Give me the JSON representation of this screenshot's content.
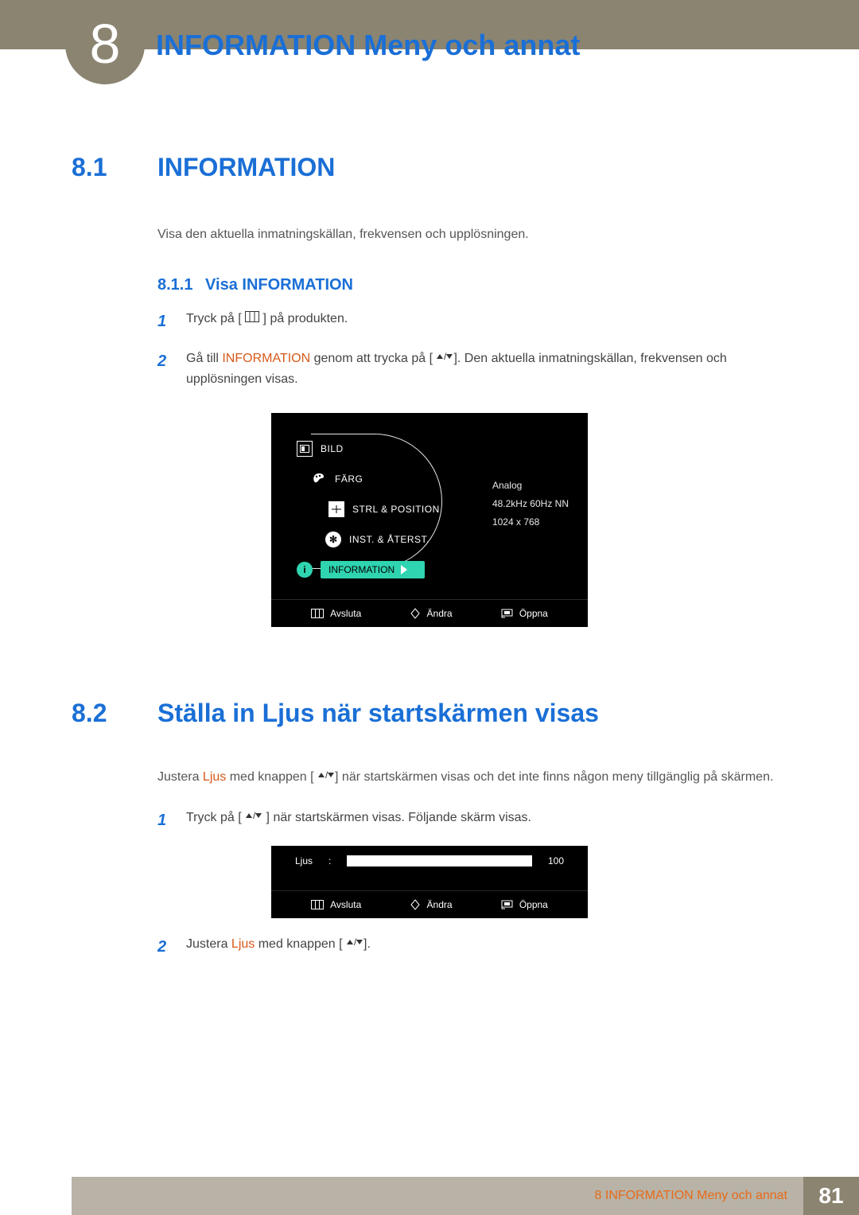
{
  "chapter": {
    "number": "8",
    "title": "INFORMATION Meny och annat"
  },
  "section1": {
    "num": "8.1",
    "title": "INFORMATION",
    "intro": "Visa den aktuella inmatningskällan, frekvensen och upplösningen.",
    "sub": {
      "num": "8.1.1",
      "title": "Visa INFORMATION"
    },
    "step1": {
      "n": "1",
      "a": "Tryck på [",
      "b": "] på produkten."
    },
    "step2": {
      "n": "2",
      "a": "Gå till ",
      "kw": "INFORMATION",
      "b": " genom att trycka på [",
      "c": "]. Den aktuella inmatningskällan, frekvensen och upplösningen visas."
    }
  },
  "osd1": {
    "items": {
      "bild": "BILD",
      "farg": "FÄRG",
      "strl": "STRL & POSITION",
      "inst": "INST. & ÅTERST.",
      "info": "INFORMATION"
    },
    "info": {
      "l1": "Analog",
      "l2": "48.2kHz 60Hz NN",
      "l3": "1024 x 768"
    },
    "footer": {
      "exit": "Avsluta",
      "change": "Ändra",
      "open": "Öppna"
    }
  },
  "section2": {
    "num": "8.2",
    "title": "Ställa in Ljus när startskärmen visas",
    "intro": {
      "a": "Justera ",
      "kw": "Ljus",
      "b": " med knappen [",
      "c": "] när startskärmen visas och det inte finns någon meny tillgänglig på skärmen."
    },
    "step1": {
      "n": "1",
      "a": "Tryck på [",
      "b": "] när startskärmen visas. Följande skärm visas."
    },
    "step2": {
      "n": "2",
      "a": "Justera ",
      "kw": "Ljus",
      "b": " med knappen [",
      "c": "]."
    }
  },
  "osd2": {
    "label": "Ljus",
    "sep": ":",
    "value": "100",
    "footer": {
      "exit": "Avsluta",
      "change": "Ändra",
      "open": "Öppna"
    }
  },
  "footer": {
    "text": "8 INFORMATION Meny och annat",
    "page": "81"
  }
}
